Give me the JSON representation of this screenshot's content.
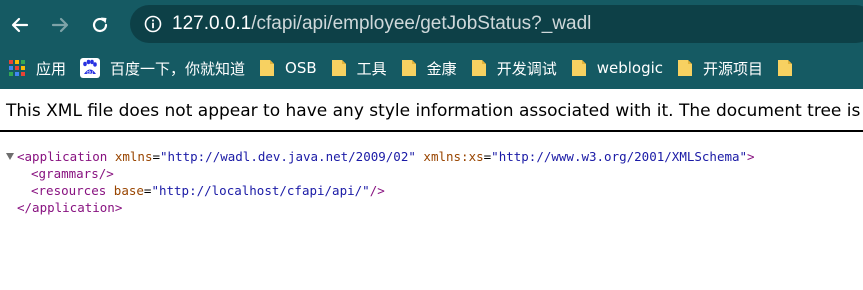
{
  "browser": {
    "url_host": "127.0.0.1",
    "url_path": "/cfapi/api/employee/getJobStatus?_wadl",
    "bookmarks": [
      {
        "label": "应用",
        "icon": "apps-grid-icon"
      },
      {
        "label": "百度一下，你就知道",
        "icon": "baidu-icon"
      },
      {
        "label": "OSB",
        "icon": "folder-icon"
      },
      {
        "label": "工具",
        "icon": "folder-icon"
      },
      {
        "label": "金康",
        "icon": "folder-icon"
      },
      {
        "label": "开发调试",
        "icon": "folder-icon"
      },
      {
        "label": "weblogic",
        "icon": "folder-icon"
      },
      {
        "label": "开源项目",
        "icon": "folder-icon"
      }
    ]
  },
  "xml_notice": "This XML file does not appear to have any style information associated with it. The document tree is",
  "xml": {
    "application_open": "<application",
    "xmlns_attr": "xmlns",
    "xmlns_value": "\"http://wadl.dev.java.net/2009/02\"",
    "xmlns_xs_attr": "xmlns:xs",
    "xmlns_xs_value": "\"http://www.w3.org/2001/XMLSchema\"",
    "close_bracket": ">",
    "grammars": "<grammars/>",
    "resources_open": "<resources",
    "base_attr": "base",
    "base_value": "\"http://localhost/cfapi/api/\"",
    "self_close": "/>",
    "application_close": "</application>"
  },
  "colors": {
    "chrome": "#155a63",
    "omnibox": "#0d4047",
    "folder": "#f7d161",
    "xml_tag": "#881280",
    "xml_attr": "#994500",
    "xml_value": "#1a1aa6"
  }
}
